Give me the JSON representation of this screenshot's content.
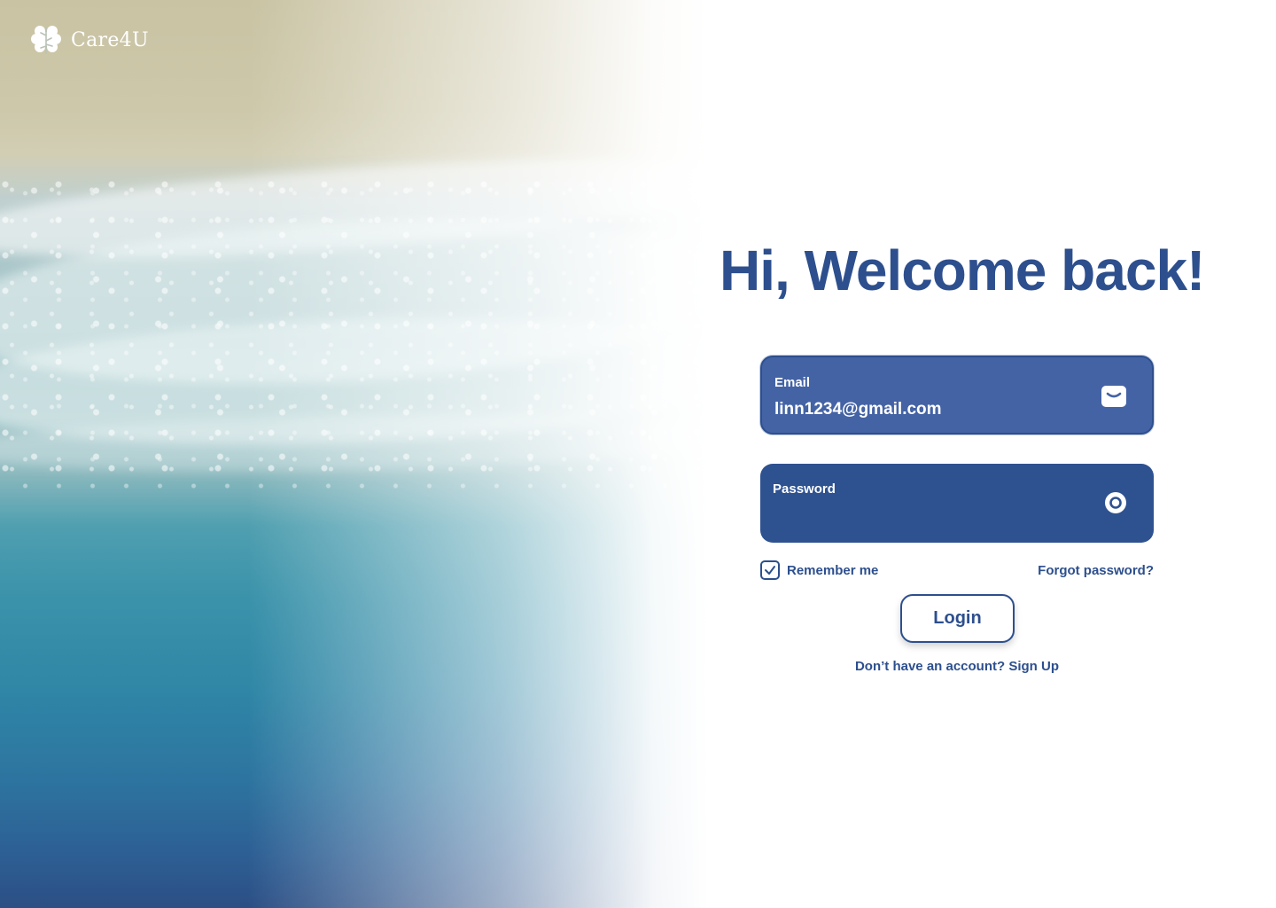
{
  "brand": {
    "name": "Care4U",
    "logo_icon": "brain-icon"
  },
  "hero": {
    "image": "aerial beach shoreline with waves"
  },
  "login": {
    "title": "Hi, Welcome back!",
    "email": {
      "label": "Email",
      "value": "linn1234@gmail.com",
      "icon": "mail-icon"
    },
    "password": {
      "label": "Password",
      "value": "",
      "icon": "eye-icon"
    },
    "remember_label": "Remember me",
    "remember_checked": true,
    "forgot_label": "Forgot password?",
    "login_label": "Login",
    "signup_prompt": "Don’t have an account?",
    "signup_link": "Sign Up"
  },
  "colors": {
    "primary": "#2d4f8e",
    "email_field": "#4463a5",
    "password_field": "#2e5190",
    "background": "#ffffff"
  }
}
